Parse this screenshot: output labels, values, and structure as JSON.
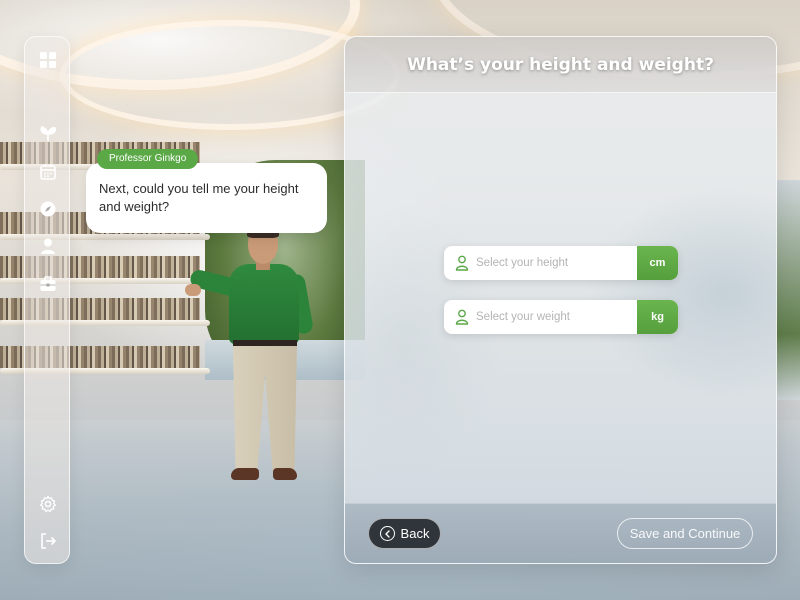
{
  "sidebar": {
    "icons": [
      "grid-icon",
      "ginkgo-leaf-icon",
      "calendar-icon",
      "compass-icon",
      "user-icon",
      "briefcase-icon",
      "settings-icon",
      "logout-icon"
    ]
  },
  "assistant": {
    "name": "Professor Ginkgo",
    "message": "Next, could you tell me your height and weight?"
  },
  "panel": {
    "title": "What’s your height and weight?",
    "height_field": {
      "placeholder": "Select your height",
      "unit": "cm"
    },
    "weight_field": {
      "placeholder": "Select your weight",
      "unit": "kg"
    }
  },
  "footer": {
    "back_label": "Back",
    "save_label": "Save and Continue"
  },
  "colors": {
    "accent_green": "#5aa846",
    "back_button_bg": "#2f353b"
  }
}
